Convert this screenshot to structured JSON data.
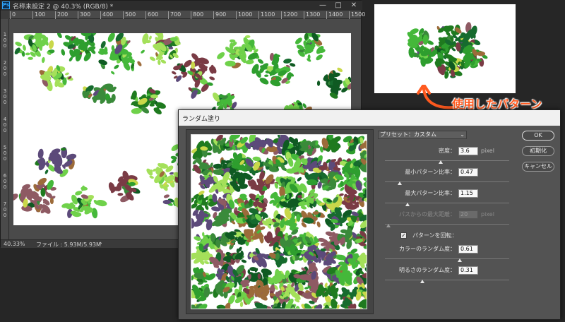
{
  "document": {
    "ps_icon": "Ps",
    "title": "名称未設定 2 @ 40.3% (RGB/8) *",
    "window_buttons": [
      "—",
      "□",
      "✕"
    ],
    "ruler_top": [
      "0",
      "100",
      "200",
      "300",
      "400",
      "500",
      "600",
      "700",
      "800",
      "900",
      "1000",
      "1100",
      "1200",
      "1300",
      "1400",
      "1500"
    ],
    "ruler_left": [
      "100",
      "200",
      "300",
      "400",
      "500",
      "600",
      "700"
    ],
    "status": {
      "zoom": "40.33%",
      "file": "ファイル : 5.93M/5.93M",
      "arrow": "›"
    }
  },
  "annotation": {
    "label": "使用したパターン",
    "color": "#ff5a1f",
    "arrow_icon": "curved-arrow-icon"
  },
  "dialog": {
    "title": "ランダム塗り",
    "preset": {
      "label": "プリセット：カスタム",
      "chevron": "⌄"
    },
    "params": [
      {
        "label": "密度：",
        "value": "3.6",
        "unit": "pixel",
        "slider": 0.45,
        "disabled": false
      },
      {
        "label": "最小パターン比率：",
        "value": "0.47",
        "unit": "",
        "slider": 0.12,
        "disabled": false
      },
      {
        "label": "最大パターン比率：",
        "value": "1.15",
        "unit": "",
        "slider": 0.18,
        "disabled": false
      },
      {
        "label": "パスからの最大距離：",
        "value": "20",
        "unit": "pixel",
        "slider": 0.03,
        "disabled": true
      }
    ],
    "rotate": {
      "label": "パターンを回転：",
      "checked": true,
      "check_glyph": "✓"
    },
    "params2": [
      {
        "label": "カラーのランダム度：",
        "value": "0.61",
        "unit": "",
        "slider": 0.6
      },
      {
        "label": "明るさのランダム度：",
        "value": "0.31",
        "unit": "",
        "slider": 0.3
      }
    ],
    "buttons": {
      "ok": "OK",
      "init": "初期化",
      "cancel": "キャンセル"
    }
  },
  "colors": {
    "leaf_palette": [
      "#1f7a1f",
      "#2e9e2e",
      "#45b83a",
      "#6fd14a",
      "#a4e05a",
      "#166b2e",
      "#7a3b45",
      "#8e5a63",
      "#5c4a7a",
      "#c9d84a",
      "#0f5a22",
      "#3a8a3a",
      "#9c6b3a"
    ]
  }
}
